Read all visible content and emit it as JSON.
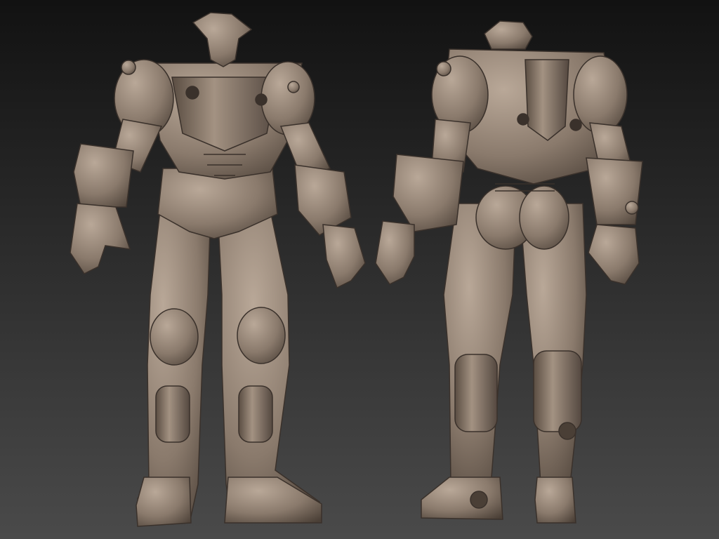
{
  "scene": {
    "background_top": "#121212",
    "background_bottom": "#4a4a4a",
    "material_base": "#8a7a6c",
    "material_light": "#b9a898",
    "material_dark": "#4a3f36",
    "groove": "#3a312b"
  },
  "figures": [
    {
      "name": "armored-figure-front-view",
      "view": "front"
    },
    {
      "name": "armored-figure-back-view",
      "view": "back"
    }
  ]
}
